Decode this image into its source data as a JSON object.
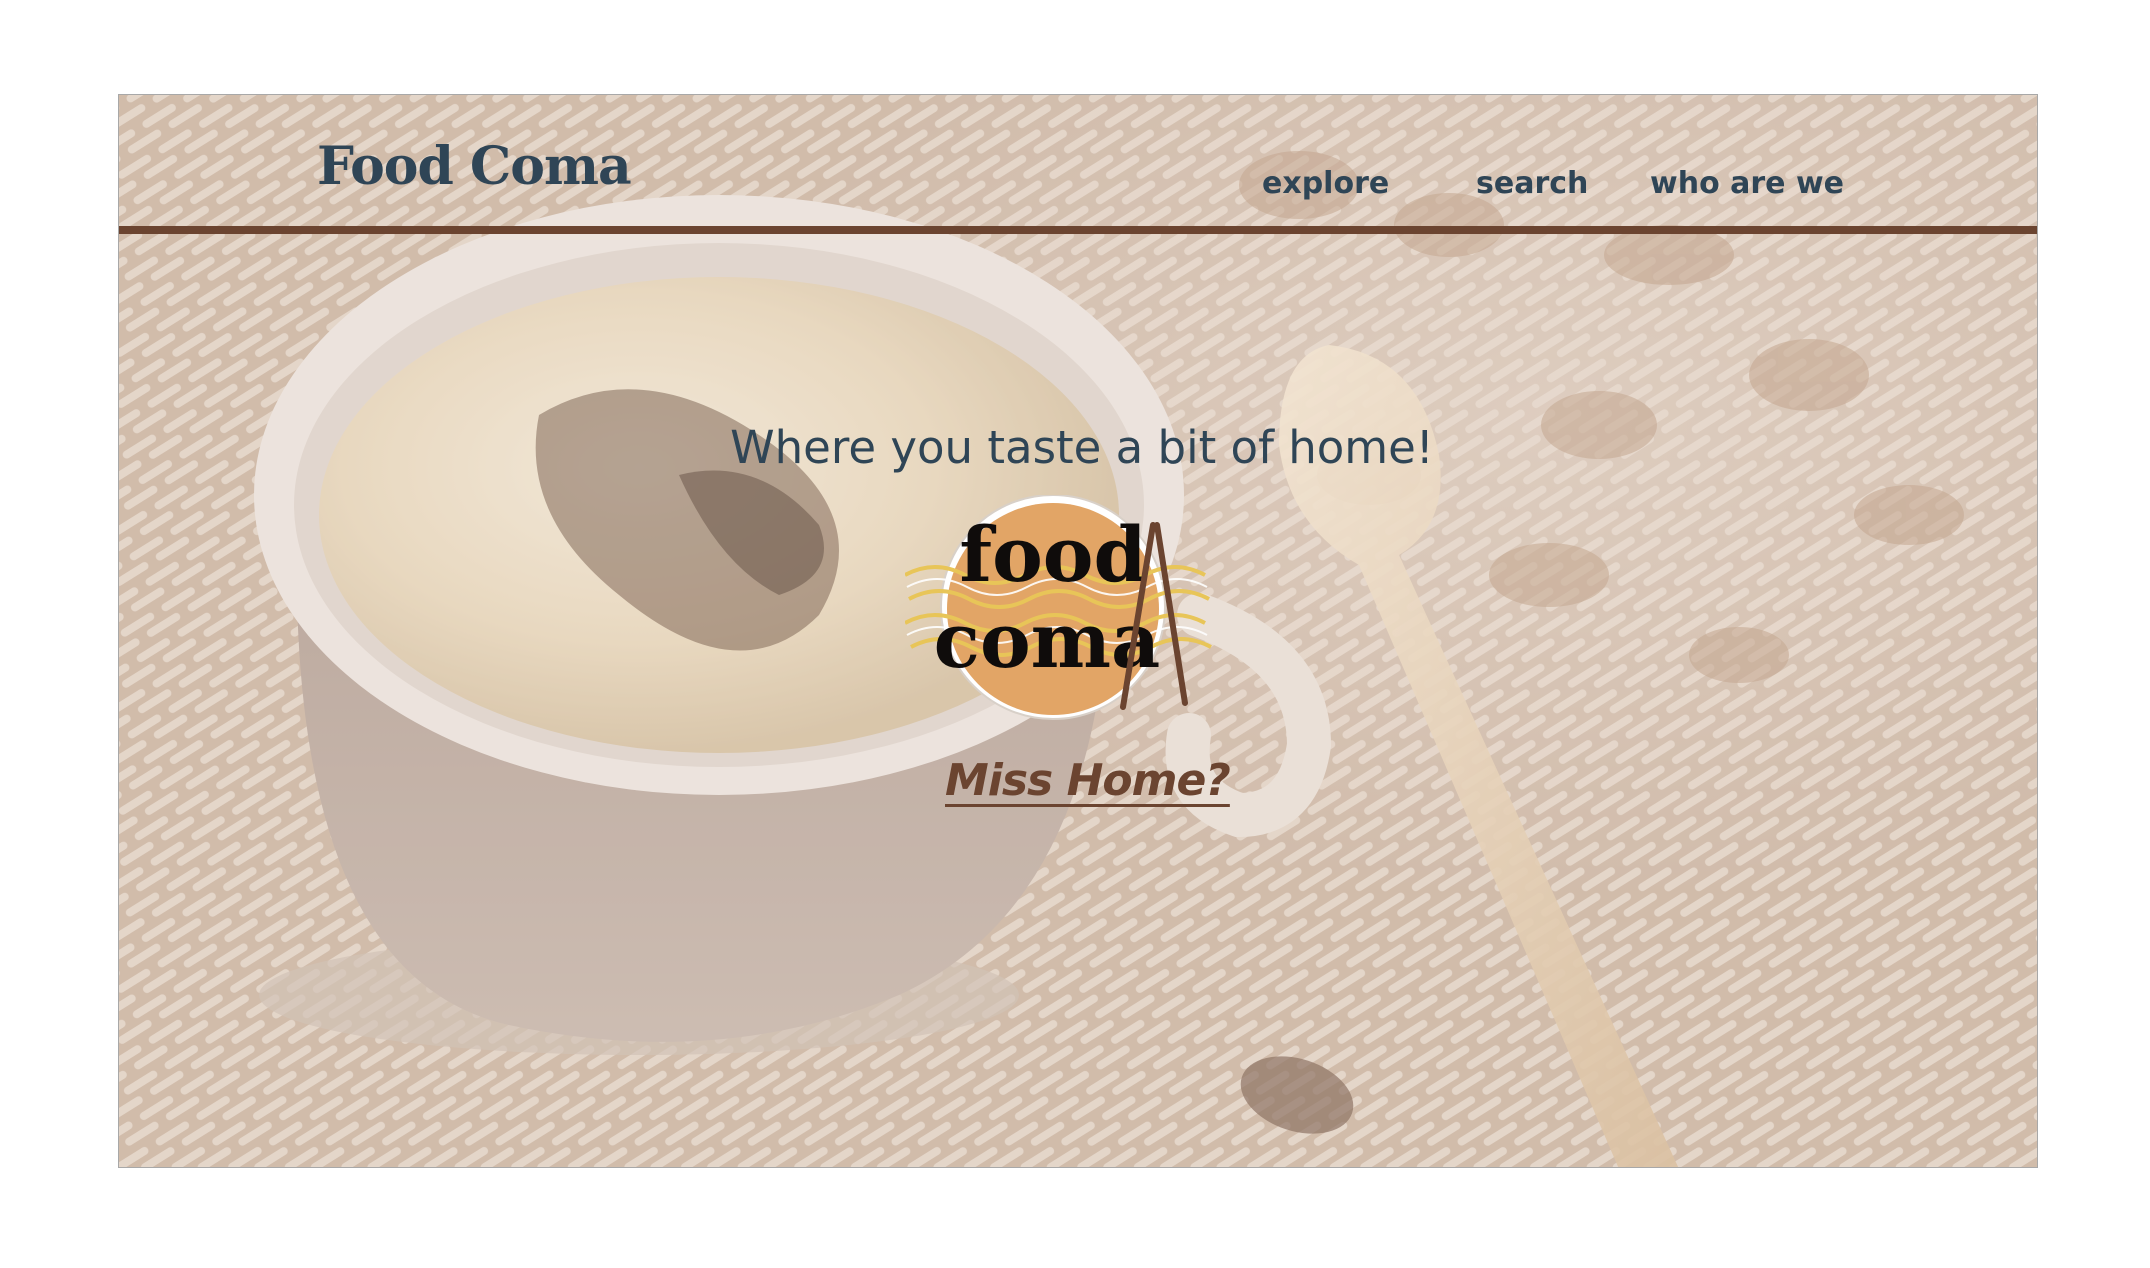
{
  "header": {
    "brand": "Food Coma",
    "nav": [
      {
        "label": "explore"
      },
      {
        "label": "search"
      },
      {
        "label": "who are we"
      }
    ]
  },
  "hero": {
    "tagline": "Where you taste a bit of home!",
    "logo": {
      "line1": "food",
      "line2": "coma",
      "icon": "food-coma-logo"
    },
    "cta_label": "Miss Home?"
  },
  "colors": {
    "text": "#2f4556",
    "accent": "#6b4430",
    "logo_fill": "#e2a566",
    "logo_waves": "#e8c558"
  },
  "background": {
    "icon": "coffee-cup-photo"
  }
}
